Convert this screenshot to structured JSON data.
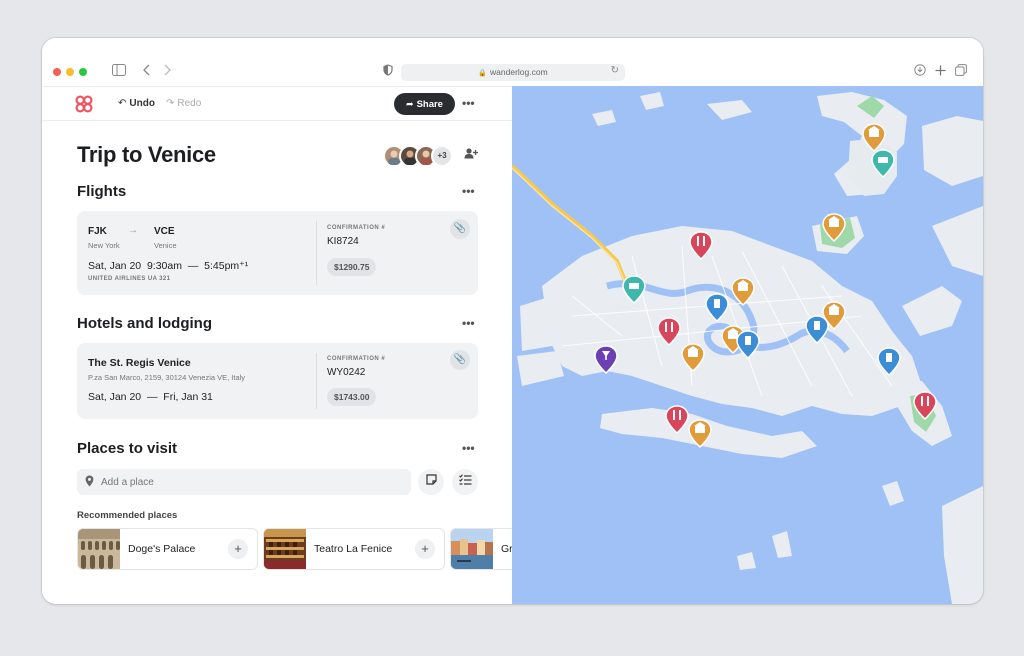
{
  "browser": {
    "url": "wanderlog.com"
  },
  "toolbar": {
    "undo_label": "Undo",
    "redo_label": "Redo",
    "share_label": "Share"
  },
  "trip": {
    "title": "Trip to Venice",
    "extra_collaborators": "+3"
  },
  "flights": {
    "section_title": "Flights",
    "from_code": "FJK",
    "from_city": "New York",
    "to_code": "VCE",
    "to_city": "Venice",
    "schedule": "Sat, Jan 20  9:30am  —  5:45pm⁺¹",
    "airline": "UNITED AIRLINES UA 321",
    "confirmation_label": "CONFIRMATION #",
    "confirmation": "KI8724",
    "price": "$1290.75"
  },
  "lodging": {
    "section_title": "Hotels and lodging",
    "name": "The St. Regis Venice",
    "address": "P.za San Marco, 2159, 30124 Venezia VE, Italy",
    "dates": "Sat, Jan 20  —  Fri, Jan 31",
    "confirmation_label": "CONFIRMATION #",
    "confirmation": "WY0242",
    "price": "$1743.00"
  },
  "places": {
    "section_title": "Places to visit",
    "placeholder": "Add a place",
    "recommended_title": "Recommended places",
    "recommended": [
      {
        "name": "Doge's Palace"
      },
      {
        "name": "Teatro La Fenice"
      },
      {
        "name": "Gra"
      }
    ]
  },
  "colors": {
    "map_water": "#a0c1f6",
    "map_land": "#e9edf1",
    "map_park": "#9fd8a9",
    "pin_orange": "#e29b3a",
    "pin_blue": "#3b8ed6",
    "pin_red": "#d9455a",
    "pin_teal": "#3fb8ac",
    "pin_purple": "#6c3fb5",
    "brand": "#f0545e"
  },
  "map_pins": [
    {
      "category": "museum-icon",
      "color": "orange"
    },
    {
      "category": "boat-icon",
      "color": "teal"
    },
    {
      "category": "museum-icon",
      "color": "orange"
    },
    {
      "category": "restaurant-icon",
      "color": "red"
    },
    {
      "category": "boat-icon",
      "color": "teal"
    },
    {
      "category": "museum-icon",
      "color": "orange"
    },
    {
      "category": "landmark-icon",
      "color": "blue"
    },
    {
      "category": "museum-icon",
      "color": "orange"
    },
    {
      "category": "restaurant-icon",
      "color": "red"
    },
    {
      "category": "landmark-icon",
      "color": "blue"
    },
    {
      "category": "museum-icon",
      "color": "orange"
    },
    {
      "category": "landmark-icon",
      "color": "blue"
    },
    {
      "category": "museum-icon",
      "color": "orange"
    },
    {
      "category": "bar-icon",
      "color": "purple"
    },
    {
      "category": "landmark-icon",
      "color": "blue"
    },
    {
      "category": "restaurant-icon",
      "color": "red"
    },
    {
      "category": "museum-icon",
      "color": "orange"
    },
    {
      "category": "restaurant-icon",
      "color": "red"
    }
  ]
}
